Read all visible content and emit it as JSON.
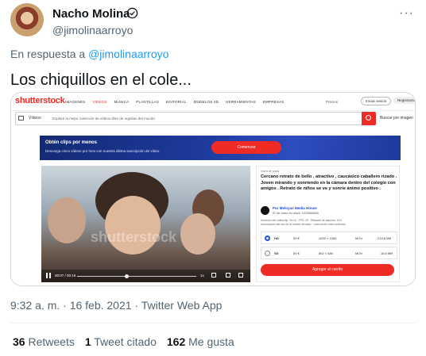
{
  "author": {
    "name": "Nacho Molina",
    "handle": "@jimolinaarroyo",
    "verified_icon": "verified-badge-icon",
    "more_icon": "more-icon"
  },
  "reply": {
    "prefix": "En respuesta a",
    "target": "@jimolinaarroyo"
  },
  "tweet_text": "Los chiquillos en el cole...",
  "embedded_page": {
    "logo": "shutterstock",
    "nav": [
      "IMÁGENES",
      "VÍDEOS",
      "MÚSICA",
      "PLANTILLAS",
      "EDITORIAL",
      "MODELOS 3D",
      "HERRAMIENTAS",
      "EMPRESAS"
    ],
    "nav_active": "VÍDEOS",
    "prices": "Precios",
    "login": "Iniciar sesión",
    "register": "Registrarse",
    "search_type": "Vídeos",
    "search_placeholder": "Explore la mejor colección de vídeos libre de regalías del mundo",
    "image_search": "Buscar por imagen",
    "promo_title": "Obtén clips por menos",
    "promo_text": "Descarga cinco vídeos por mes con nuestra última suscripción de vídeo",
    "promo_button": "Comenzar",
    "video_time": "00:07 / 00:16",
    "video_speed": "1x",
    "watermark": "shutterstock",
    "info_label": "Vídeo de stock",
    "info_title": "Cercano retrato de bello , atractivo , caucásico caballero rizado . Joven mirando y sonriendo en la cámara dentro del colegio con amigos . Retrato de niños se ve y sonríe ánimo positivo .",
    "contributor_by": "Por Meloyan Media House",
    "clip_id": "ID de vídeo en stock: 1023568630",
    "meta_line1": "Duración del vídeo/clip: 00:16 · FPS: 25 · Relación de aspecto: 16:9",
    "meta_line2": "Autorización del uso de la modelo firmada · Licencia de vídeo ordinaria",
    "formats": [
      {
        "quality": "HD",
        "price": "59 €",
        "resolution": "1920 × 1080",
        "format": "MOV",
        "size": "215,8 MB",
        "selected": true
      },
      {
        "quality": "SD",
        "price": "59 €",
        "resolution": "852 × 480",
        "format": "MOV",
        "size": "16,6 MB",
        "selected": false
      }
    ],
    "cart_button": "Agregar al carrito"
  },
  "timestamp": "9:32 a. m. · 16 feb. 2021 · Twitter Web App",
  "stats": {
    "retweets_count": "36",
    "retweets_label": "Retweets",
    "quotes_count": "1",
    "quotes_label": "Tweet citado",
    "likes_count": "162",
    "likes_label": "Me gusta"
  },
  "colors": {
    "link": "#1d9bf0",
    "shutterstock_red": "#ee2b24",
    "promo_blue": "#1d3a9c",
    "muted": "#536471"
  }
}
